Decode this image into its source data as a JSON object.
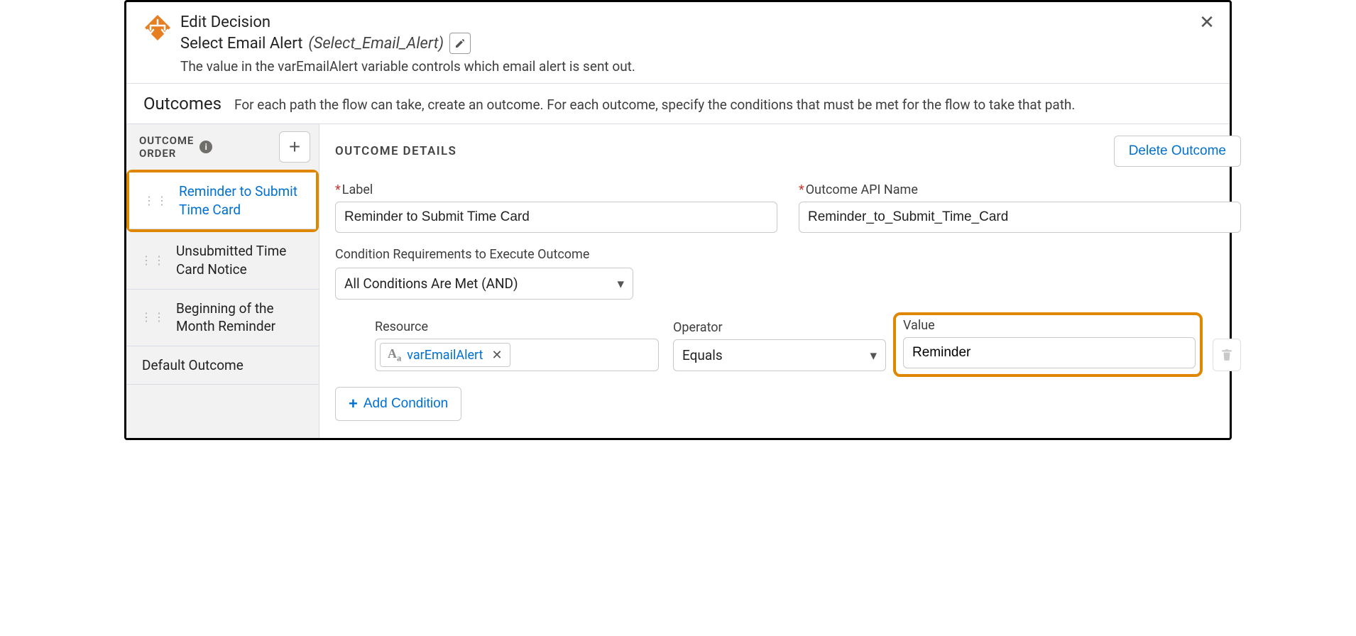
{
  "header": {
    "title": "Edit Decision",
    "element_label": "Select Email Alert",
    "api_name": "(Select_Email_Alert)",
    "description": "The value in the varEmailAlert variable controls which email alert is sent out."
  },
  "outcomes_section": {
    "heading": "Outcomes",
    "description": "For each path the flow can take, create an outcome. For each outcome, specify the conditions that must be met for the flow to take that path."
  },
  "sidebar": {
    "title_line1": "OUTCOME",
    "title_line2": "ORDER",
    "items": [
      {
        "label": "Reminder to Submit Time Card",
        "selected": true
      },
      {
        "label": "Unsubmitted Time Card Notice",
        "selected": false
      },
      {
        "label": "Beginning of the Month Reminder",
        "selected": false
      }
    ],
    "default_label": "Default Outcome"
  },
  "details": {
    "heading": "OUTCOME DETAILS",
    "delete_label": "Delete Outcome",
    "label_field": {
      "label": "Label",
      "value": "Reminder to Submit Time Card"
    },
    "api_field": {
      "label": "Outcome API Name",
      "value": "Reminder_to_Submit_Time_Card"
    },
    "cond_req": {
      "label": "Condition Requirements to Execute Outcome",
      "value": "All Conditions Are Met (AND)"
    },
    "condition": {
      "resource_label": "Resource",
      "resource_value": "varEmailAlert",
      "operator_label": "Operator",
      "operator_value": "Equals",
      "value_label": "Value",
      "value_value": "Reminder"
    },
    "add_condition_label": "Add Condition"
  }
}
